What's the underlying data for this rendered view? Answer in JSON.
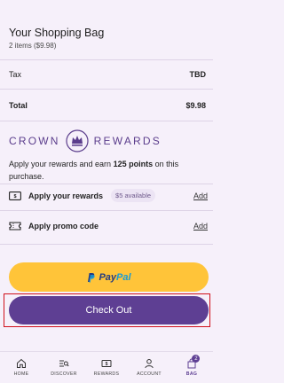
{
  "header": {
    "title": "Your Shopping Bag",
    "subtitle": "2 items ($9.98)"
  },
  "summary": {
    "tax_label": "Tax",
    "tax_value": "TBD",
    "total_label": "Total",
    "total_value": "$9.98"
  },
  "rewards": {
    "brand_left": "CROWN",
    "brand_right": "REWARDS",
    "promo_prefix": "Apply your rewards and earn ",
    "promo_points": "125 points",
    "promo_suffix": " on this purchase.",
    "apply_rewards_label": "Apply your rewards",
    "available_badge": "$5 available",
    "apply_rewards_link": "Add",
    "promo_code_label": "Apply promo code",
    "promo_code_link": "Add"
  },
  "buttons": {
    "paypal_pay": "Pay",
    "paypal_pal": "Pal",
    "checkout": "Check Out"
  },
  "tabbar": {
    "home": "HOME",
    "discover": "DISCOVER",
    "rewards": "REWARDS",
    "account": "ACCOUNT",
    "bag": "BAG",
    "bag_count": "2"
  },
  "colors": {
    "background": "#f6f0fa",
    "primary_purple": "#5e3f93",
    "paypal_yellow": "#ffc439",
    "highlight_red": "#d0101b"
  }
}
